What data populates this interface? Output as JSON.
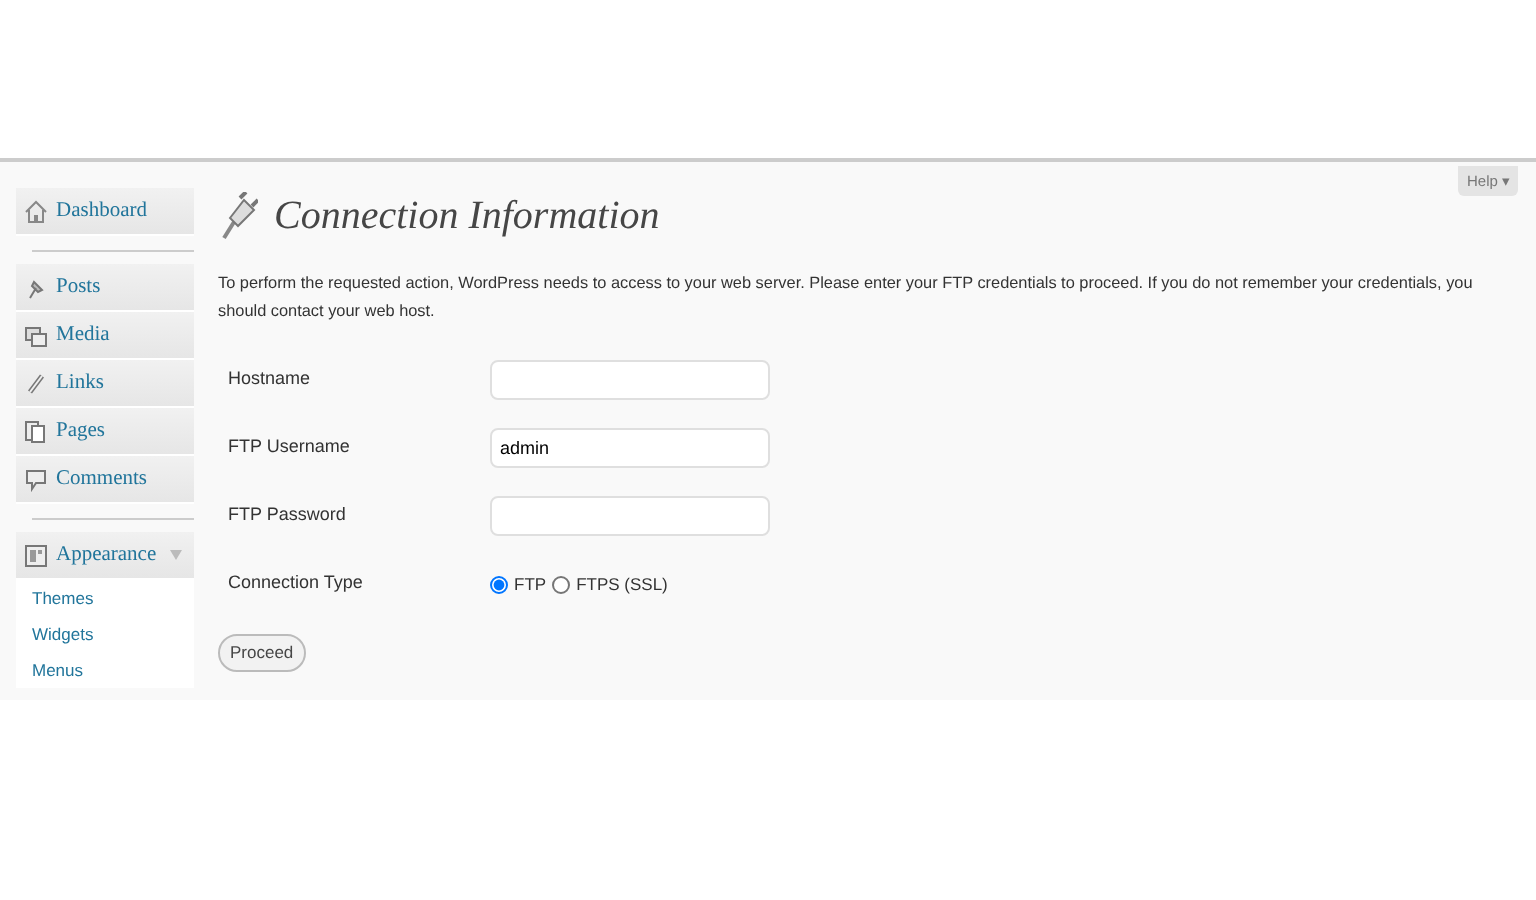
{
  "help_button": "Help ▾",
  "sidebar": {
    "groups": [
      {
        "items": [
          {
            "label": "Dashboard",
            "kind": "house"
          }
        ]
      },
      {
        "items": [
          {
            "label": "Posts",
            "kind": "pin"
          },
          {
            "label": "Media",
            "kind": "media"
          },
          {
            "label": "Links",
            "kind": "link"
          },
          {
            "label": "Pages",
            "kind": "pages"
          },
          {
            "label": "Comments",
            "kind": "comment"
          }
        ]
      },
      {
        "items": [
          {
            "label": "Appearance",
            "kind": "appearance",
            "expanded": true,
            "children": [
              {
                "label": "Themes"
              },
              {
                "label": "Widgets"
              },
              {
                "label": "Menus"
              }
            ]
          }
        ]
      }
    ]
  },
  "page_title": "Connection Information",
  "description": "To perform the requested action, WordPress needs to access to your web server. Please enter your FTP credentials to proceed. If you do not remember your credentials, you should contact your web host.",
  "fields": [
    {
      "label": "Hostname",
      "kind": "text"
    },
    {
      "label": "FTP Username",
      "kind": "text",
      "value": "admin"
    },
    {
      "label": "FTP Password",
      "kind": "password"
    },
    {
      "label": "Connection Type",
      "kind": "radio",
      "options": [
        {
          "label": "FTP",
          "selected": true
        },
        {
          "label": "FTPS (SSL)",
          "selected": false
        }
      ]
    }
  ],
  "submit_button": "Proceed"
}
